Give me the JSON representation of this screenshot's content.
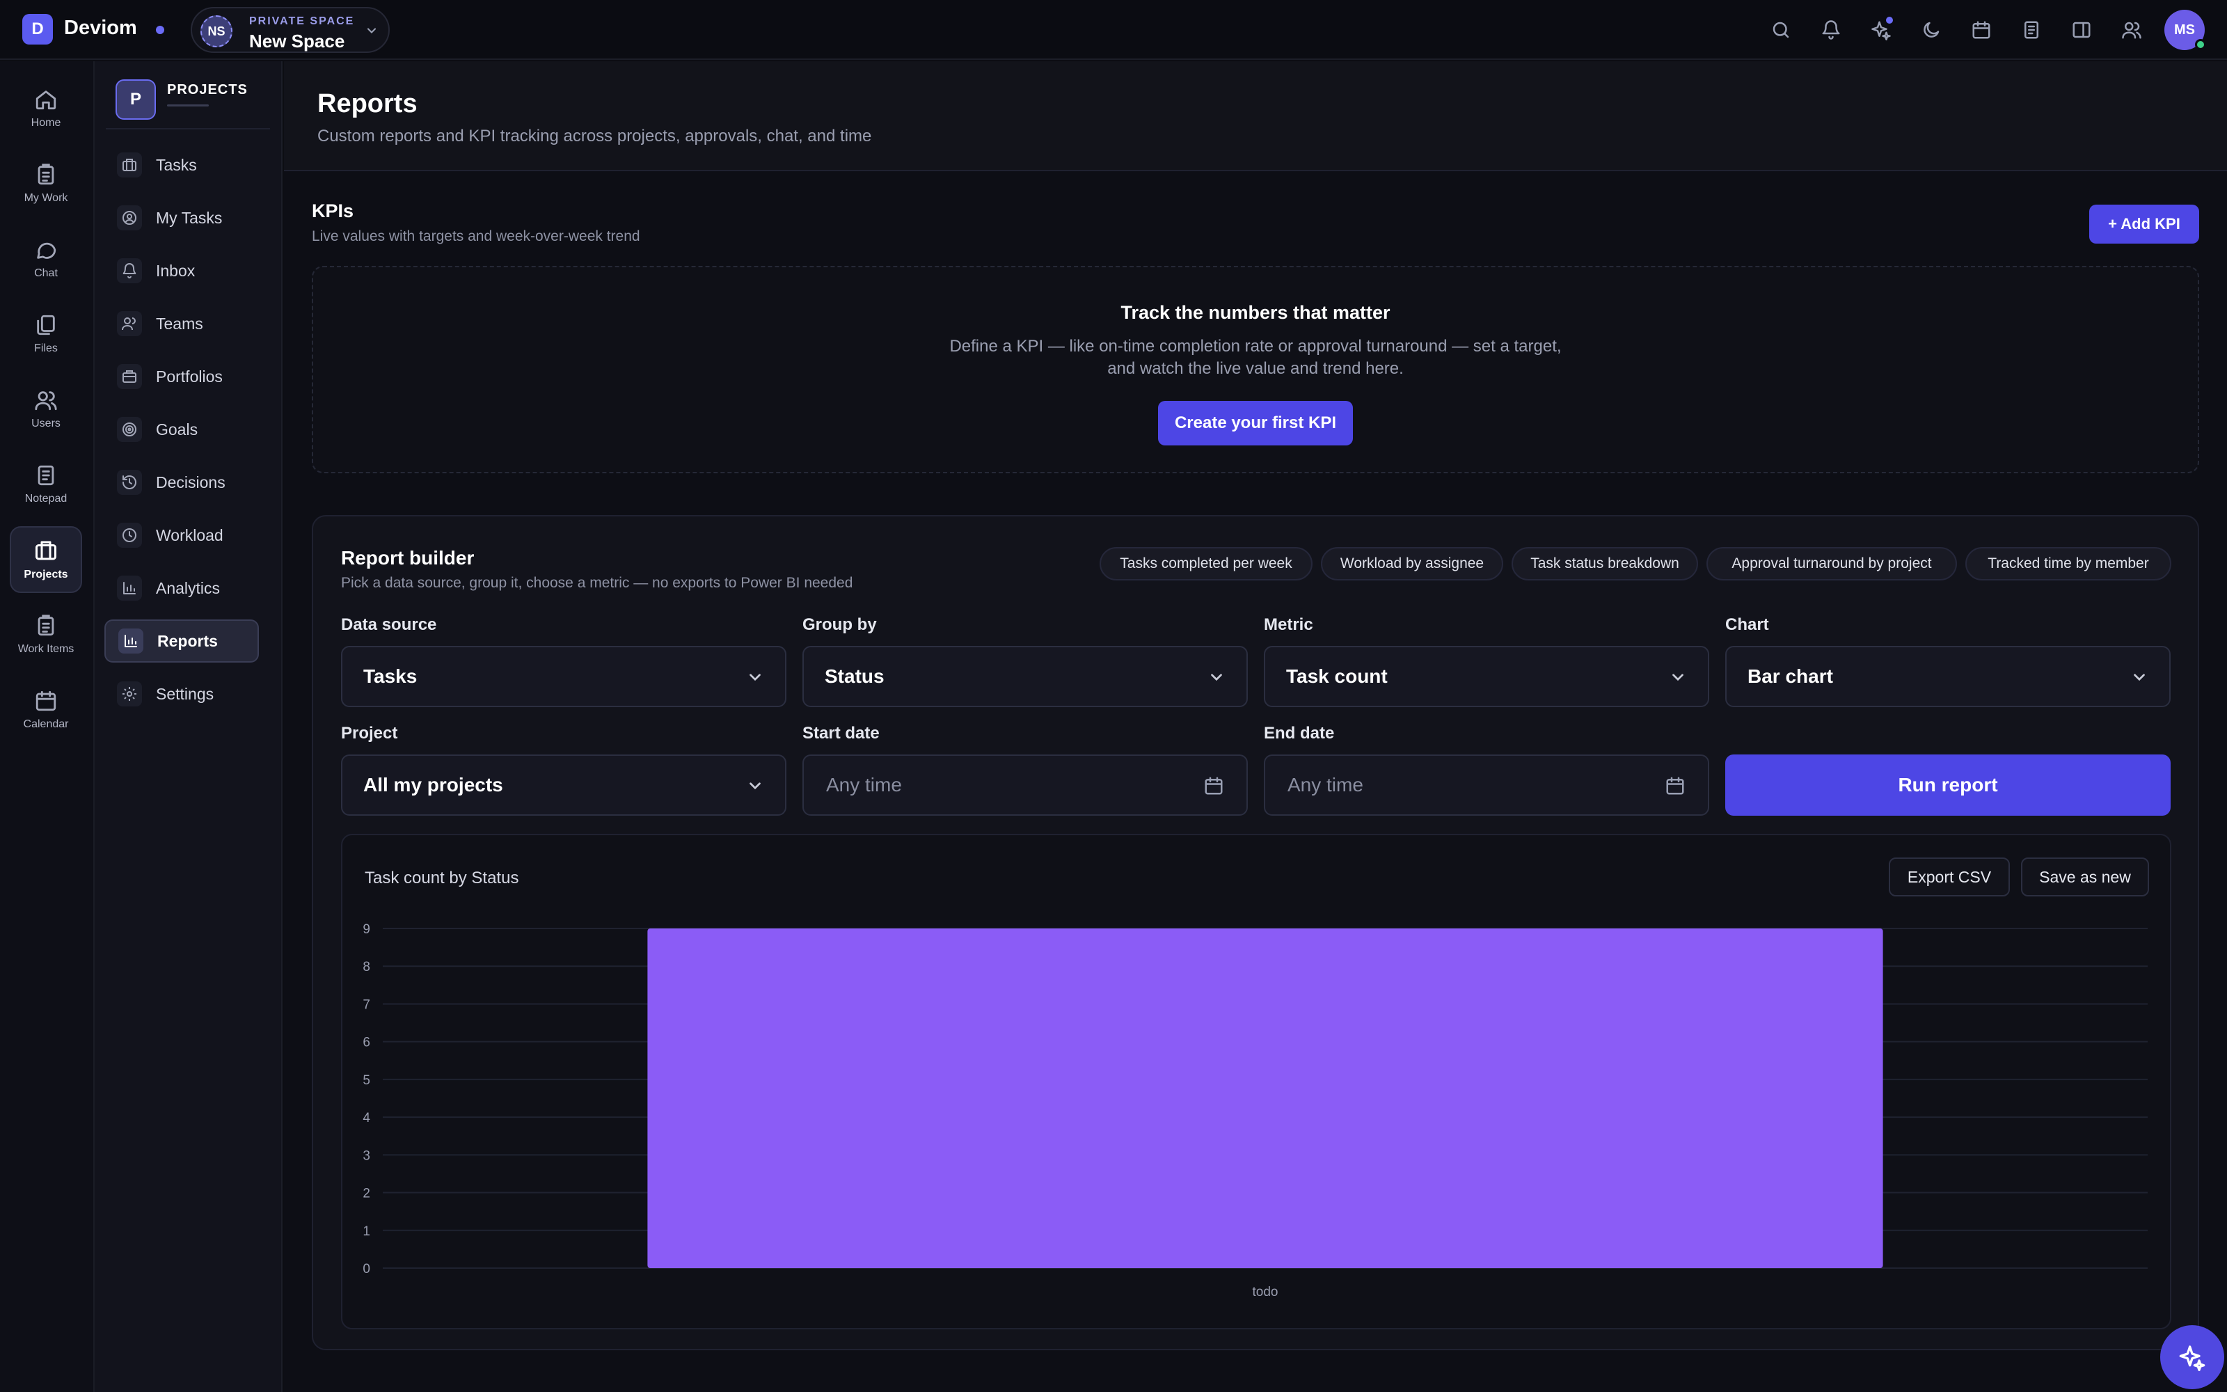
{
  "brand": {
    "initial": "D",
    "name": "Deviom"
  },
  "space": {
    "initials": "NS",
    "kicker": "PRIVATE SPACE",
    "name": "New Space"
  },
  "user": {
    "initials": "MS"
  },
  "topbar_icons": [
    "search-icon",
    "bell-icon",
    "sparkles-icon",
    "moon-icon",
    "calendar-icon",
    "notepad-icon",
    "sidebar-toggle-icon",
    "users-icon"
  ],
  "rail": {
    "items": [
      {
        "label": "Home",
        "icon": "home-icon"
      },
      {
        "label": "My Work",
        "icon": "clipboard-icon"
      },
      {
        "label": "Chat",
        "icon": "chat-icon"
      },
      {
        "label": "Files",
        "icon": "files-icon"
      },
      {
        "label": "Users",
        "icon": "users-icon"
      },
      {
        "label": "Notepad",
        "icon": "notepad-icon"
      },
      {
        "label": "Projects",
        "icon": "briefcase-icon"
      },
      {
        "label": "Work Items",
        "icon": "clipboard-icon"
      },
      {
        "label": "Calendar",
        "icon": "calendar-icon"
      }
    ],
    "active": "Projects"
  },
  "project_nav": {
    "badge": "P",
    "title": "PROJECTS",
    "items": [
      {
        "label": "Tasks",
        "icon": "briefcase-icon"
      },
      {
        "label": "My Tasks",
        "icon": "user-circle-icon"
      },
      {
        "label": "Inbox",
        "icon": "bell-icon"
      },
      {
        "label": "Teams",
        "icon": "users-icon"
      },
      {
        "label": "Portfolios",
        "icon": "portfolio-icon"
      },
      {
        "label": "Goals",
        "icon": "target-icon"
      },
      {
        "label": "Decisions",
        "icon": "history-icon"
      },
      {
        "label": "Workload",
        "icon": "clock-icon"
      },
      {
        "label": "Analytics",
        "icon": "bar-chart-icon"
      },
      {
        "label": "Reports",
        "icon": "bar-chart-icon"
      },
      {
        "label": "Settings",
        "icon": "gear-icon"
      }
    ],
    "active": "Reports"
  },
  "page": {
    "title": "Reports",
    "subtitle": "Custom reports and KPI tracking across projects, approvals, chat, and time"
  },
  "kpis": {
    "title": "KPIs",
    "subtitle": "Live values with targets and week-over-week trend",
    "add_label": "+ Add KPI",
    "empty_title": "Track the numbers that matter",
    "empty_line1": "Define a KPI — like on-time completion rate or approval turnaround — set a target,",
    "empty_line2": "and watch the live value and trend here.",
    "create_label": "Create your first KPI"
  },
  "builder": {
    "title": "Report builder",
    "subtitle": "Pick a data source, group it, choose a metric — no exports to Power BI needed",
    "presets": [
      "Tasks completed per week",
      "Workload by assignee",
      "Task status breakdown",
      "Approval turnaround by project",
      "Tracked time by member"
    ],
    "fields": {
      "data_source": {
        "label": "Data source",
        "value": "Tasks"
      },
      "group_by": {
        "label": "Group by",
        "value": "Status"
      },
      "metric": {
        "label": "Metric",
        "value": "Task count"
      },
      "chart": {
        "label": "Chart",
        "value": "Bar chart"
      },
      "project": {
        "label": "Project",
        "value": "All my projects"
      },
      "start_date": {
        "label": "Start date",
        "placeholder": "Any time"
      },
      "end_date": {
        "label": "End date",
        "placeholder": "Any time"
      }
    },
    "run_label": "Run report",
    "export_label": "Export CSV",
    "save_label": "Save as new"
  },
  "chart_data": {
    "type": "bar",
    "title": "Task count by Status",
    "categories": [
      "todo"
    ],
    "values": [
      9
    ],
    "ylim": [
      0,
      9
    ],
    "yticks": [
      "0",
      "1",
      "2",
      "3",
      "4",
      "5",
      "6",
      "7",
      "8",
      "9"
    ],
    "bar_color": "#8b5cf6",
    "grid": true
  },
  "colors": {
    "accent": "#4d46e5",
    "bar": "#8b5cf6",
    "background": "#0d0e15"
  }
}
